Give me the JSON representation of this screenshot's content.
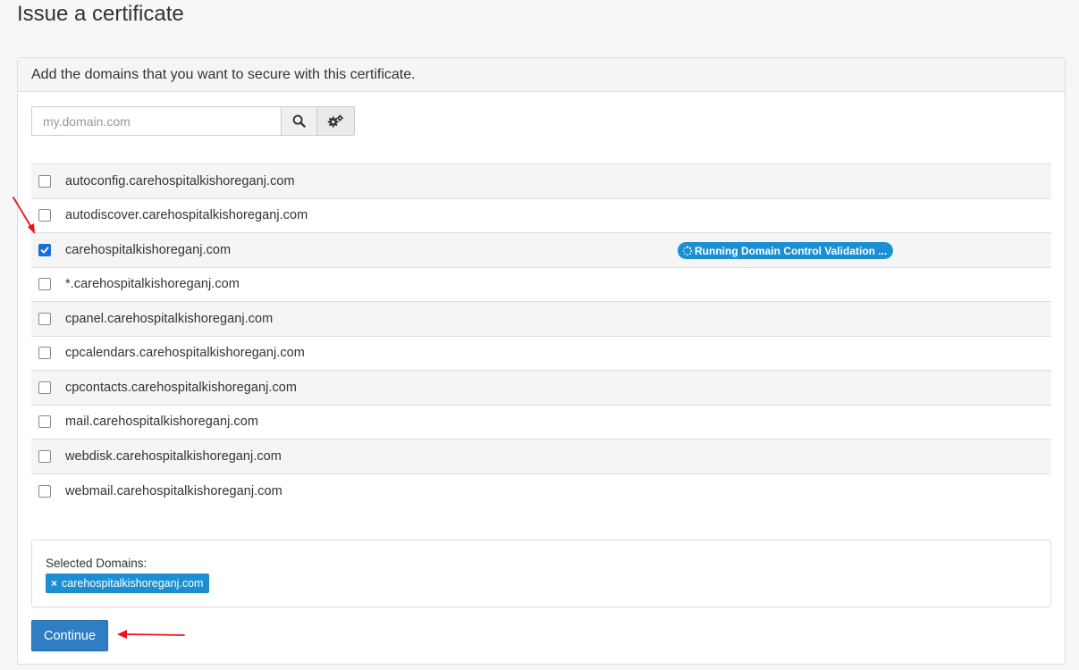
{
  "page": {
    "title": "Issue a certificate"
  },
  "panel": {
    "heading": "Add the domains that you want to secure with this certificate."
  },
  "search": {
    "placeholder": "my.domain.com",
    "search_icon": "search-icon",
    "options_icon": "gears-icon"
  },
  "domains": [
    {
      "label": "autoconfig.carehospitalkishoreganj.com",
      "checked": false
    },
    {
      "label": "autodiscover.carehospitalkishoreganj.com",
      "checked": false
    },
    {
      "label": "carehospitalkishoreganj.com",
      "checked": true,
      "status": "Running Domain Control Validation ..."
    },
    {
      "label": "*.carehospitalkishoreganj.com",
      "checked": false
    },
    {
      "label": "cpanel.carehospitalkishoreganj.com",
      "checked": false
    },
    {
      "label": "cpcalendars.carehospitalkishoreganj.com",
      "checked": false
    },
    {
      "label": "cpcontacts.carehospitalkishoreganj.com",
      "checked": false
    },
    {
      "label": "mail.carehospitalkishoreganj.com",
      "checked": false
    },
    {
      "label": "webdisk.carehospitalkishoreganj.com",
      "checked": false
    },
    {
      "label": "webmail.carehospitalkishoreganj.com",
      "checked": false
    }
  ],
  "selected": {
    "label": "Selected Domains:",
    "tags": [
      "carehospitalkishoreganj.com"
    ],
    "remove_glyph": "×"
  },
  "actions": {
    "continue_label": "Continue"
  },
  "colors": {
    "accent": "#1b8fd1",
    "primary_button": "#2f7ec4",
    "checkbox_checked": "#1a6fd6",
    "annotation_arrow": "#e8141b"
  }
}
